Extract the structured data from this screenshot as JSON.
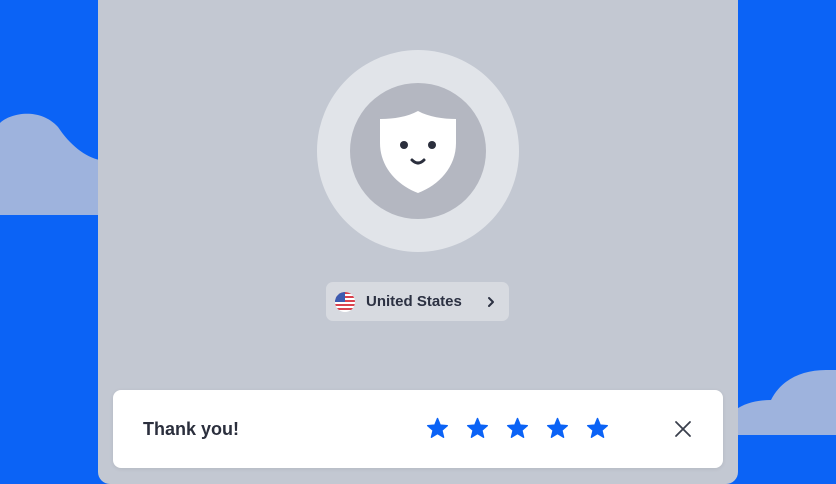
{
  "country": {
    "name": "United States",
    "flag_icon": "us-flag-icon"
  },
  "rating": {
    "message": "Thank you!",
    "stars": 5,
    "max_stars": 5,
    "star_color": "#0b63f6",
    "close_icon": "close-icon"
  },
  "colors": {
    "background": "#0b63f6",
    "window": "#c3c8d2"
  }
}
